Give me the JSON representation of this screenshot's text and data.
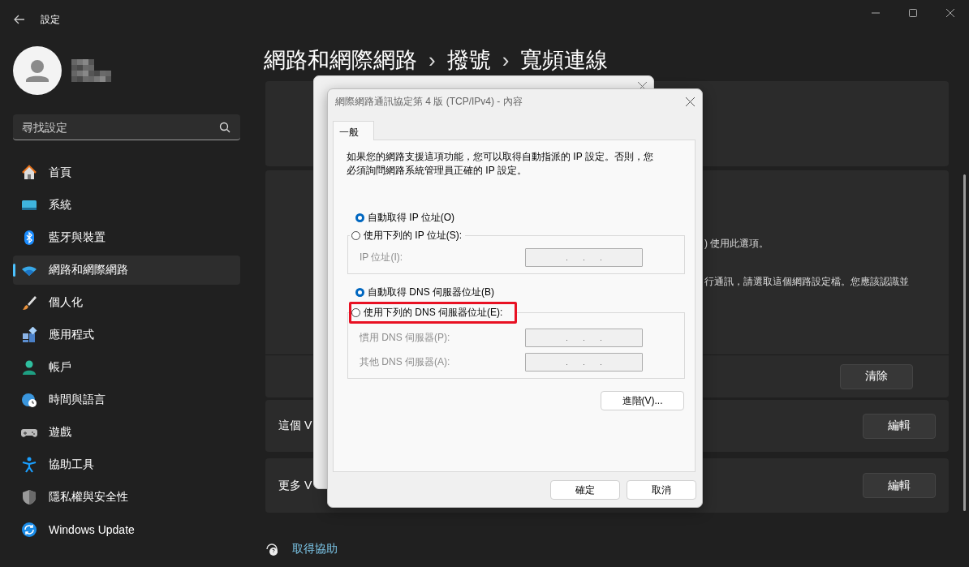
{
  "window": {
    "title": "設定"
  },
  "search": {
    "placeholder": "尋找設定"
  },
  "sidebar": {
    "items": [
      {
        "label": "首頁",
        "selected": false
      },
      {
        "label": "系統",
        "selected": false
      },
      {
        "label": "藍牙與裝置",
        "selected": false
      },
      {
        "label": "網路和網際網路",
        "selected": true
      },
      {
        "label": "個人化",
        "selected": false
      },
      {
        "label": "應用程式",
        "selected": false
      },
      {
        "label": "帳戶",
        "selected": false
      },
      {
        "label": "時間與語言",
        "selected": false
      },
      {
        "label": "遊戲",
        "selected": false
      },
      {
        "label": "協助工具",
        "selected": false
      },
      {
        "label": "隱私權與安全性",
        "selected": false
      },
      {
        "label": "Windows Update",
        "selected": false
      }
    ]
  },
  "breadcrumb": {
    "items": [
      "網路和網際網路",
      "撥號",
      "寬頻連線"
    ],
    "separator": "›"
  },
  "panels": [
    {
      "kind": "blank"
    },
    {
      "kind": "text",
      "lines": [
        ") 使用此選項。",
        "行通訊，請選取這個網路設定檔。您應該認識並"
      ]
    },
    {
      "kind": "action",
      "button": "清除"
    },
    {
      "kind": "row",
      "label": "這個 V",
      "button": "編輯"
    },
    {
      "kind": "row",
      "label": "更多 V",
      "button": "編輯"
    }
  ],
  "help": {
    "label": "取得協助"
  },
  "dialog": {
    "title": "網際網路通訊協定第 4 版 (TCP/IPv4) - 內容",
    "tabs": [
      {
        "label": "一般",
        "selected": true
      }
    ],
    "description": "如果您的網路支援這項功能，您可以取得自動指派的 IP 設定。否則，您必須詢問網路系統管理員正確的 IP 設定。",
    "sections": [
      {
        "options": [
          {
            "label": "自動取得 IP 位址(O)",
            "selected": true,
            "highlighted": false
          },
          {
            "label": "使用下列的 IP 位址(S):",
            "selected": false,
            "highlighted": false
          }
        ],
        "fields": [
          {
            "label": "IP 位址(I):",
            "disabled": true
          }
        ]
      },
      {
        "options": [
          {
            "label": "自動取得 DNS 伺服器位址(B)",
            "selected": true,
            "highlighted": false
          },
          {
            "label": "使用下列的 DNS 伺服器位址(E):",
            "selected": false,
            "highlighted": true
          }
        ],
        "fields": [
          {
            "label": "慣用 DNS 伺服器(P):",
            "disabled": true
          },
          {
            "label": "其他 DNS 伺服器(A):",
            "disabled": true
          }
        ]
      }
    ],
    "advanced_button": "進階(V)...",
    "buttons": [
      "確定",
      "取消"
    ]
  }
}
